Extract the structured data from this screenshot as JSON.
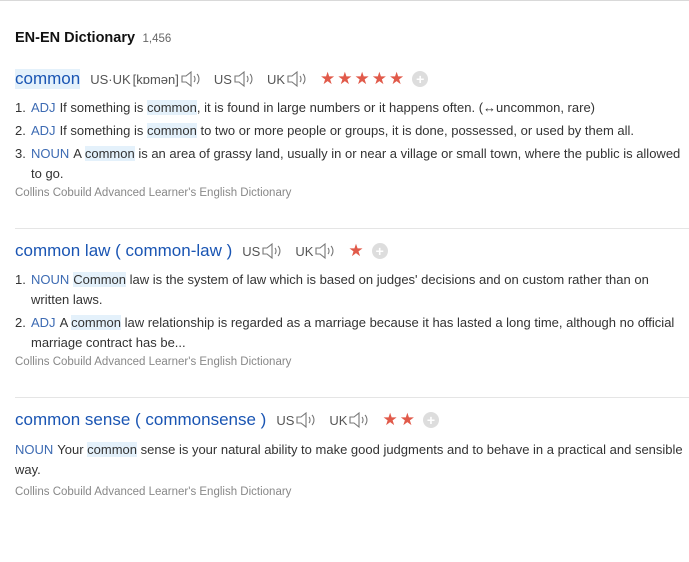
{
  "header": {
    "title": "EN-EN Dictionary",
    "count": "1,456"
  },
  "entries": [
    {
      "headword": "common",
      "pron_label": "US·UK",
      "phonetic": "[kɒmən]",
      "us": "US",
      "uk": "UK",
      "stars": "★★★★★",
      "defs": [
        {
          "num": "1.",
          "pos": "ADJ",
          "pre": "If something is ",
          "kw": "common",
          "post": ", it is found in large numbers or it happens often. (↔uncommon, rare)"
        },
        {
          "num": "2.",
          "pos": "ADJ",
          "pre": "If something is ",
          "kw": "common",
          "post": " to two or more people or groups, it is done, possessed, or used by them all."
        },
        {
          "num": "3.",
          "pos": "NOUN",
          "pre": "A ",
          "kw": "common",
          "post": " is an area of grassy land, usually in or near a village or small town, where the public is allowed to go."
        }
      ],
      "source": "Collins Cobuild Advanced Learner's English Dictionary"
    },
    {
      "hw_a": "common",
      "hw_b": " law ( ",
      "hw_c": "common",
      "hw_d": "-law )",
      "us": "US",
      "uk": "UK",
      "stars": "★",
      "defs": [
        {
          "num": "1.",
          "pos": "NOUN",
          "pre": "",
          "kw": "Common",
          "post": " law is the system of law which is based on judges' decisions and on custom rather than on written laws."
        },
        {
          "num": "2.",
          "pos": "ADJ",
          "pre": "A ",
          "kw": "common",
          "post": " law relationship is regarded as a marriage because it has lasted a long time, although no official marriage contract has be..."
        }
      ],
      "source": "Collins Cobuild Advanced Learner's English Dictionary"
    },
    {
      "hw_a": "common",
      "hw_b": " sense ( commonsense )",
      "us": "US",
      "uk": "UK",
      "stars": "★★",
      "def": {
        "pos": "NOUN",
        "pre": "Your ",
        "kw": "common",
        "post": " sense is your natural ability to make good judgments and to behave in a practical and sensible way."
      },
      "source": "Collins Cobuild Advanced Learner's English Dictionary"
    }
  ],
  "icons": {
    "speaker": "speaker-icon",
    "add": "plus-icon"
  },
  "colors": {
    "headword": "#1a55b3",
    "highlight": "#e4f1fb",
    "stars": "#e15a4a",
    "pos": "#3d6bb3"
  }
}
